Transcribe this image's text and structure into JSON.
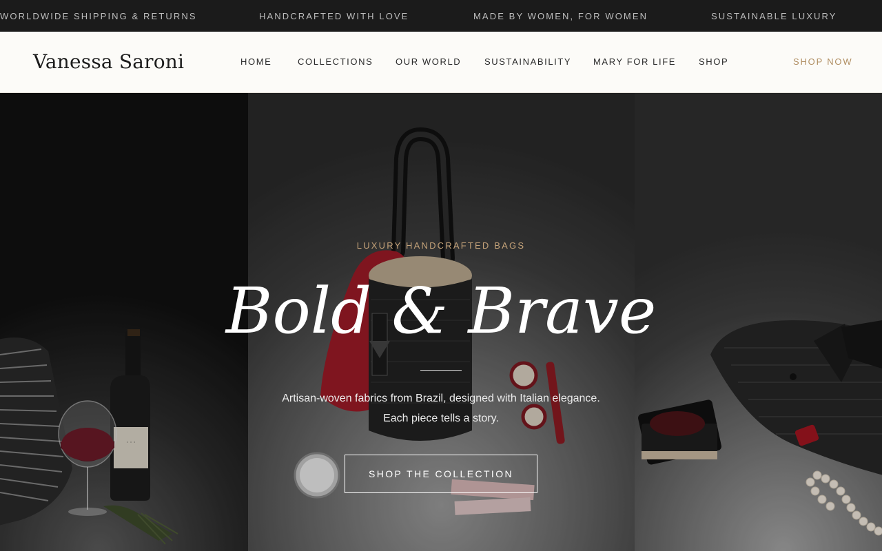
{
  "announcement": {
    "items": [
      "WORLDWIDE SHIPPING & RETURNS",
      "HANDCRAFTED WITH LOVE",
      "MADE BY WOMEN, FOR WOMEN",
      "SUSTAINABLE LUXURY"
    ]
  },
  "header": {
    "logo": "Vanessa Saroni",
    "nav": [
      "HOME",
      "COLLECTIONS",
      "OUR WORLD",
      "SUSTAINABILITY",
      "MARY FOR LIFE",
      "SHOP"
    ],
    "cta_label": "SHOP NOW"
  },
  "hero": {
    "eyebrow": "LUXURY HANDCRAFTED BAGS",
    "headline": "Bold & Brave",
    "subtext": "Artisan-woven fabrics from Brazil, designed with Italian elegance. Each piece tells a story.",
    "cta_label": "SHOP THE COLLECTION"
  },
  "colors": {
    "accent_gold": "#b08e62",
    "announce_bg": "#1b1b1b",
    "header_bg": "#fcfbf8"
  }
}
